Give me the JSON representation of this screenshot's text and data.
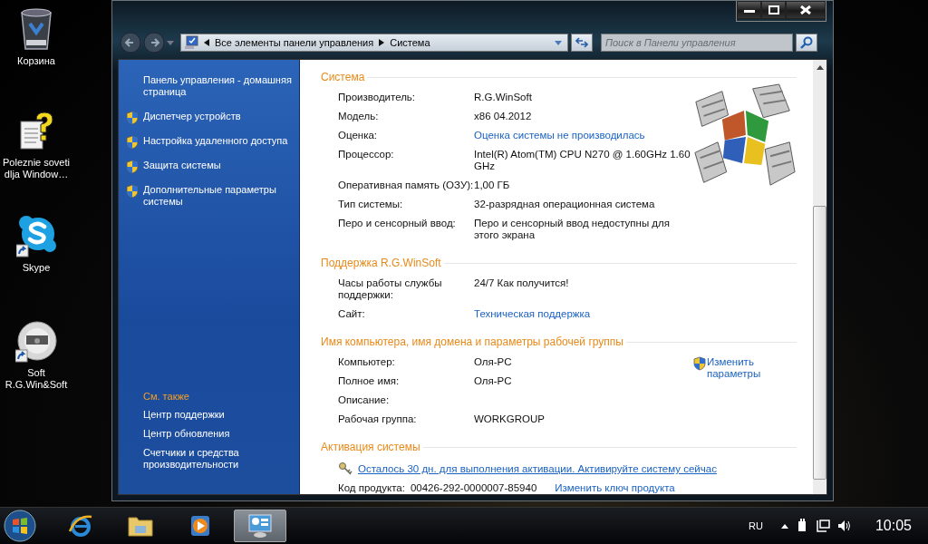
{
  "desktop_icons": [
    {
      "label": "Корзина",
      "kind": "recycle-bin",
      "shortcut": false
    },
    {
      "label": "Poleznie soveti dlja Window…",
      "kind": "help-document",
      "shortcut": false
    },
    {
      "label": "Skype",
      "kind": "skype",
      "shortcut": true
    },
    {
      "label": "Soft R.G.Win&Soft",
      "kind": "disc",
      "shortcut": true
    }
  ],
  "window": {
    "breadcrumb": [
      "Все элементы панели управления",
      "Система"
    ],
    "search": {
      "placeholder": "Поиск в Панели управления"
    },
    "sidebar": {
      "home_link": "Панель управления - домашняя страница",
      "tasks": [
        {
          "label": "Диспетчер устройств"
        },
        {
          "label": "Настройка удаленного доступа"
        },
        {
          "label": "Защита системы"
        },
        {
          "label": "Дополнительные параметры системы"
        }
      ],
      "see_also": {
        "title": "См. также",
        "links": [
          "Центр поддержки",
          "Центр обновления",
          "Счетчики и средства производительности"
        ]
      }
    },
    "sections": [
      {
        "kind": "system",
        "title": "Система",
        "rows": [
          {
            "label": "Производитель:",
            "value": "R.G.WinSoft",
            "link": false
          },
          {
            "label": "Модель:",
            "value": "x86 04.2012",
            "link": false
          },
          {
            "label": "Оценка:",
            "value": "Оценка системы не производилась",
            "link": true
          },
          {
            "label": "Процессор:",
            "value": "Intel(R) Atom(TM) CPU N270   @ 1.60GHz   1.60 GHz",
            "link": false
          },
          {
            "label": "Оперативная память (ОЗУ):",
            "value": "1,00 ГБ",
            "link": false
          },
          {
            "label": "Тип системы:",
            "value": "32-разрядная операционная система",
            "link": false
          },
          {
            "label": "Перо и сенсорный ввод:",
            "value": "Перо и сенсорный ввод недоступны для этого экрана",
            "link": false
          }
        ]
      },
      {
        "kind": "support",
        "title": "Поддержка R.G.WinSoft",
        "rows": [
          {
            "label": "Часы работы службы поддержки:",
            "value": "24/7 Как получится!",
            "link": false
          },
          {
            "label": "Сайт:",
            "value": "Техническая поддержка",
            "link": true
          }
        ]
      },
      {
        "kind": "computer",
        "title": "Имя компьютера, имя домена и параметры рабочей группы",
        "change_link": "Изменить параметры",
        "rows": [
          {
            "label": "Компьютер:",
            "value": "Оля-PC",
            "link": false
          },
          {
            "label": "Полное имя:",
            "value": "Оля-PC",
            "link": false
          },
          {
            "label": "Описание:"
          },
          {
            "label": "Рабочая группа:",
            "value": "WORKGROUP",
            "link": false
          }
        ]
      },
      {
        "kind": "activation",
        "title": "Активация системы",
        "activation_link": "Осталось 30 дн. для выполнения активации. Активируйте систему сейчас",
        "product_key_label": "Код продукта:",
        "product_key": "00426-292-0000007-85940",
        "change_key_link": "Изменить ключ продукта"
      }
    ]
  },
  "taskbar": {
    "apps": [
      {
        "kind": "browser",
        "selected": false
      },
      {
        "kind": "folder",
        "selected": false
      },
      {
        "kind": "media",
        "selected": false
      },
      {
        "kind": "control-panel",
        "selected": true
      }
    ],
    "language": "RU",
    "time": "10:05"
  }
}
